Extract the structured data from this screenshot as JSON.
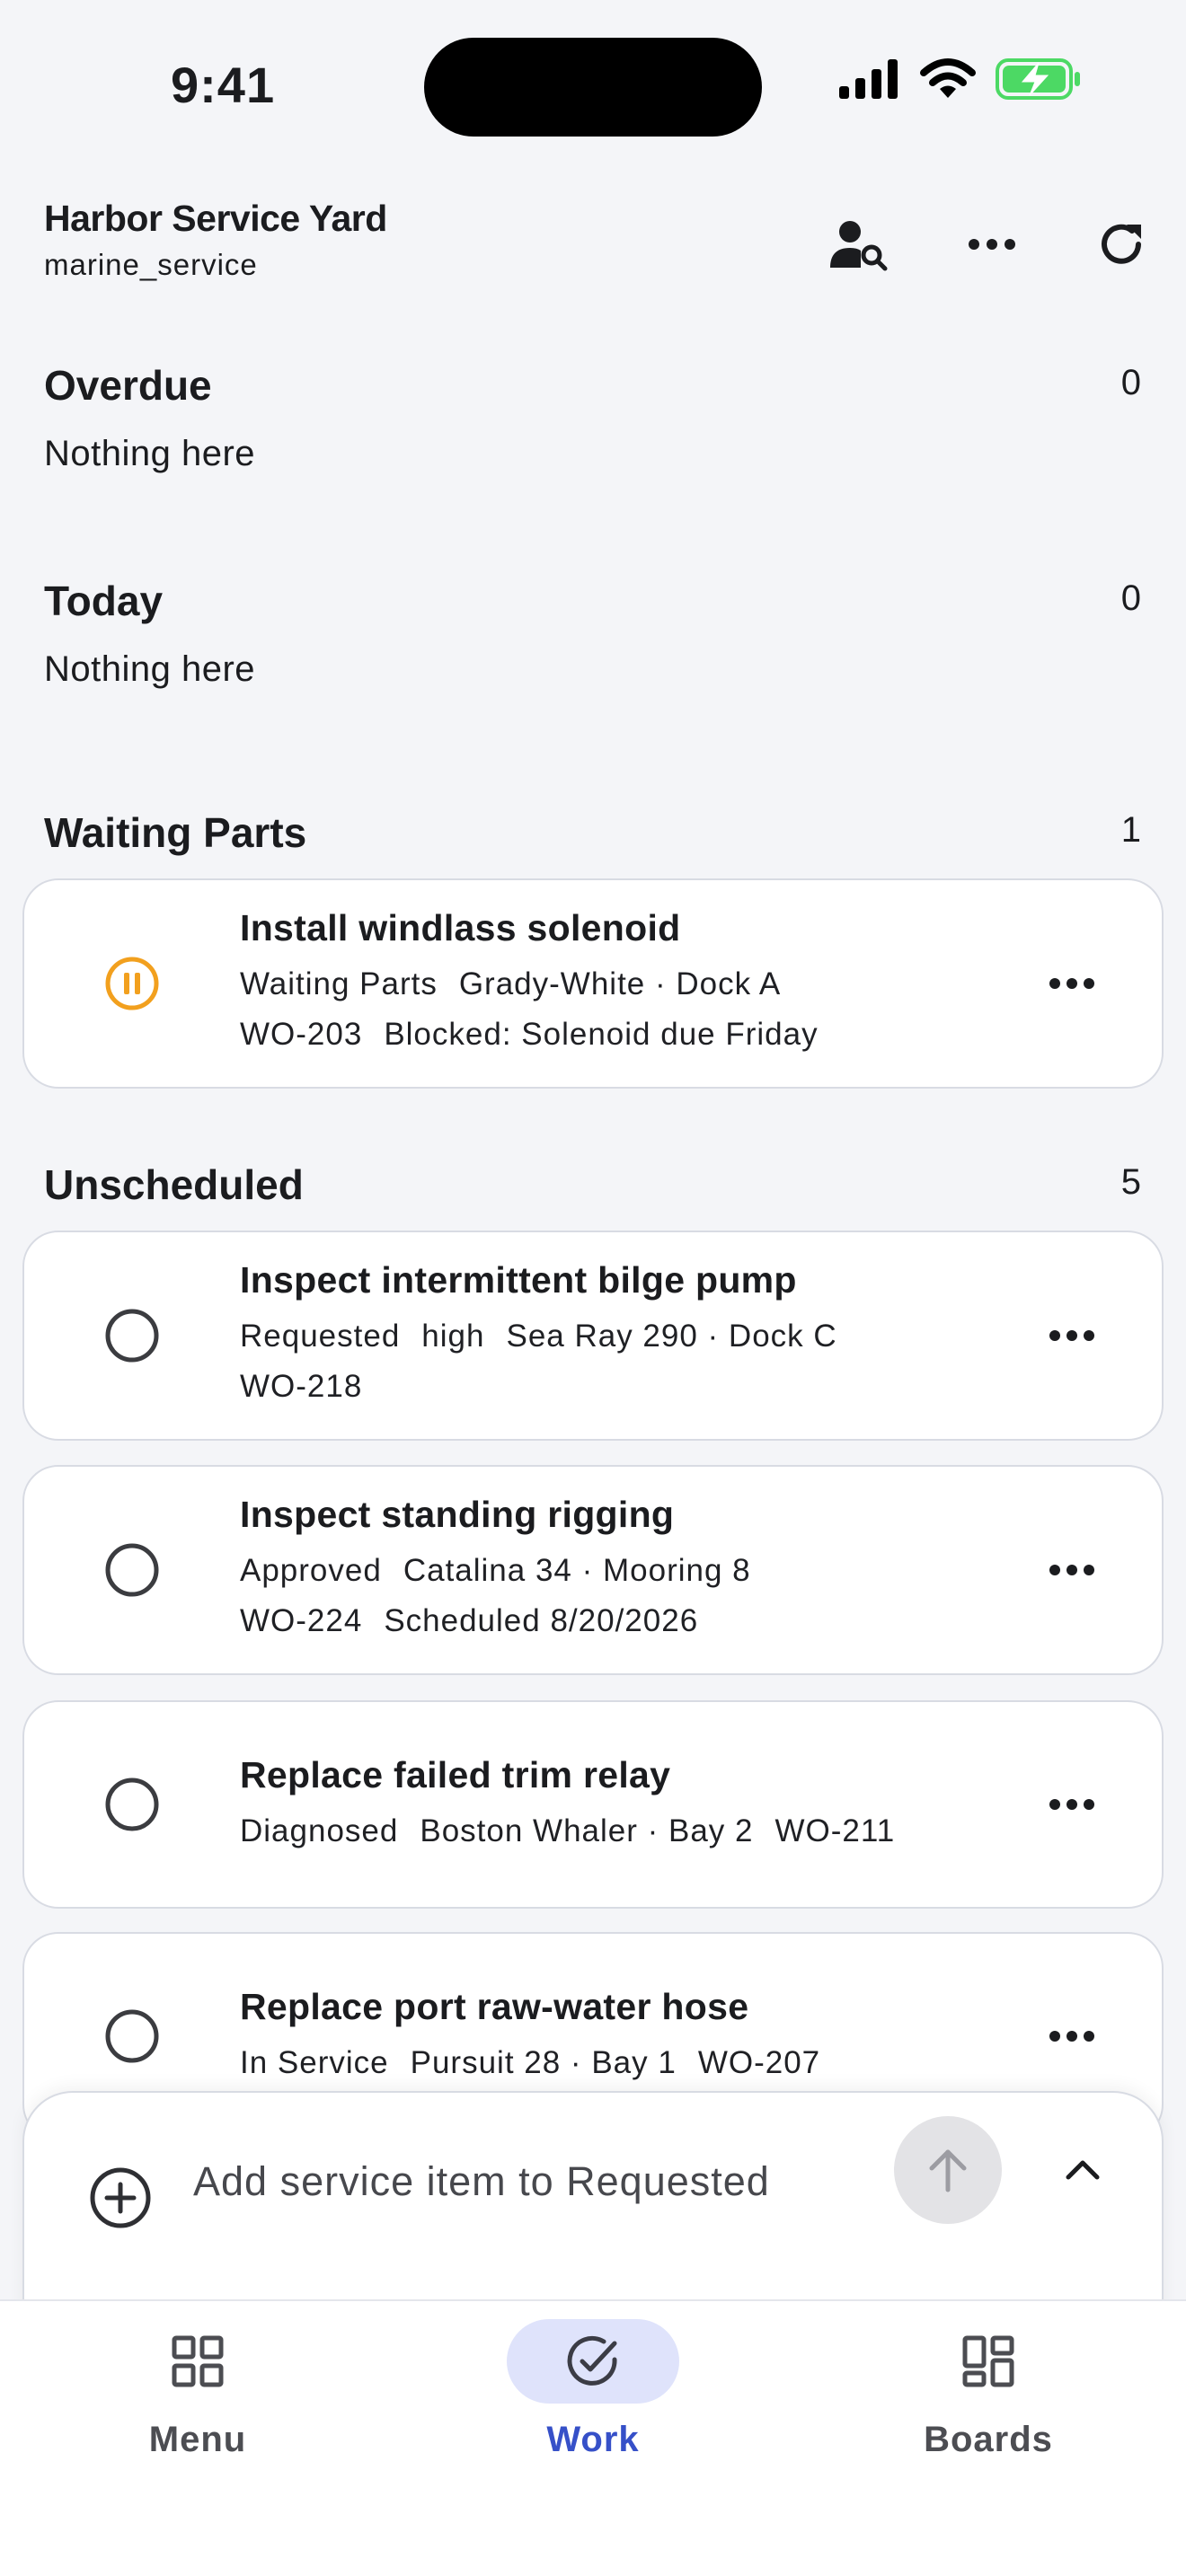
{
  "status_bar": {
    "time": "9:41"
  },
  "header": {
    "title": "Harbor Service Yard",
    "subtitle": "marine_service",
    "icons": [
      "person-search-icon",
      "more-horizontal-icon",
      "refresh-icon"
    ]
  },
  "sections": {
    "overdue": {
      "title": "Overdue",
      "count": "0",
      "empty_text": "Nothing here"
    },
    "today": {
      "title": "Today",
      "count": "0",
      "empty_text": "Nothing here"
    },
    "waiting_parts": {
      "title": "Waiting Parts",
      "count": "1",
      "items": [
        {
          "title": "Install windlass solenoid",
          "status": "Waiting Parts",
          "vessel": "Grady-White · Dock A",
          "wo": "WO-203",
          "note": "Blocked: Solenoid due Friday",
          "status_icon": "pause-circle-icon"
        }
      ]
    },
    "unscheduled": {
      "title": "Unscheduled",
      "count": "5",
      "items": [
        {
          "title": "Inspect intermittent bilge pump",
          "status": "Requested",
          "priority": "high",
          "vessel": "Sea Ray 290 · Dock C",
          "wo": "WO-218"
        },
        {
          "title": "Inspect standing rigging",
          "status": "Approved",
          "vessel": "Catalina 34 · Mooring 8",
          "wo": "WO-224",
          "note": "Scheduled 8/20/2026"
        },
        {
          "title": "Replace failed trim relay",
          "status": "Diagnosed",
          "vessel": "Boston Whaler · Bay 2",
          "wo": "WO-211"
        },
        {
          "title": "Replace port raw-water hose",
          "status": "In Service",
          "vessel": "Pursuit 28 · Bay 1",
          "wo": "WO-207"
        }
      ]
    }
  },
  "composer": {
    "placeholder": "Add service item to Requested"
  },
  "tabs": [
    {
      "label": "Menu",
      "icon": "grid-icon"
    },
    {
      "label": "Work",
      "icon": "check-circle-icon",
      "active": true
    },
    {
      "label": "Boards",
      "icon": "dashboard-icon"
    }
  ],
  "colors": {
    "accent": "#3650c8",
    "accent_bg": "#dfe3fb",
    "waiting": "#f2a01e",
    "battery": "#4cd964"
  }
}
